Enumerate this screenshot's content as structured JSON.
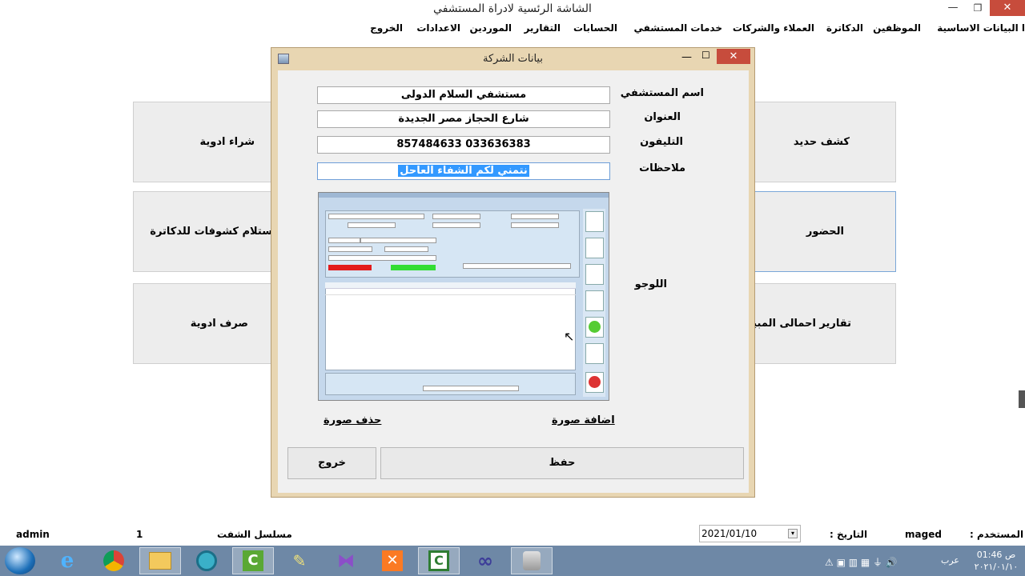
{
  "window": {
    "title": "الشاشة الرئسية لادراة المستشفي"
  },
  "menu": [
    "ا البيانات الاساسية",
    "الموظفين",
    "الدكاترة",
    "العملاء والشركات",
    "خدمات المستشفي",
    "الحسابات",
    "التقارير",
    "الموردين",
    "الاعدادات",
    "الخروج"
  ],
  "tiles": {
    "new_exam": "كشف حديد",
    "buy_meds": "شراء ادوية",
    "attendance": "الحضور",
    "receive_exams": "ستلام كشوفات للدكاترة",
    "sales_reports": "تقارير احمالى المبيعات",
    "dispense_meds": "صرف ادوية"
  },
  "dialog": {
    "title": "بيانات الشركة",
    "labels": {
      "hospital_name": "اسم المستشفي",
      "address": "العنوان",
      "phone": "التليفون",
      "notes": "ملاحظات",
      "logo": "اللوجو"
    },
    "values": {
      "hospital_name": "مستشفي السلام الدولى",
      "address": "شارع الحجاز مصر الجديدة",
      "phone": "033636383   857484633",
      "notes": "نتمني لكم الشفاء العاحل"
    },
    "add_image": "اضافة صورة",
    "delete_image": "حذف صورة",
    "save": "حفظ",
    "exit": "خروج"
  },
  "status": {
    "user_label": "المستخدم :",
    "user_value": "maged",
    "date_label": "التاريخ :",
    "date_value": "2021/01/10",
    "shift_label": "مسلسل الشفت",
    "shift_value": "1",
    "admin": "admin"
  },
  "taskbar": {
    "apps": [
      "ie-icon",
      "chrome-icon",
      "folder-icon",
      "media-icon",
      "camtasia-icon",
      "tools-icon",
      "visual-studio-icon",
      "xampp-icon",
      "camtasia2-icon",
      "infinity-icon",
      "database-icon"
    ],
    "lang": "عرب",
    "time": "01:46 ص",
    "date": "٢٠٢١/٠١/١٠"
  }
}
